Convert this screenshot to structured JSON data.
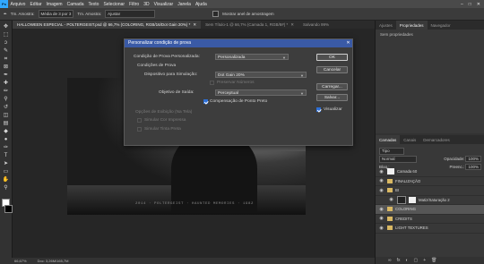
{
  "app": {
    "logo": "Ps"
  },
  "menu": [
    "Arquivo",
    "Editar",
    "Imagem",
    "Camada",
    "Texto",
    "Selecionar",
    "Filtro",
    "3D",
    "Visualizar",
    "Janela",
    "Ajuda"
  ],
  "window_controls": [
    "–",
    "□",
    "✕"
  ],
  "options_bar": {
    "size_label": "Tm. Amostra:",
    "size_value": "Média de 3 por 3",
    "sample_label": "Tm. Amostra:",
    "sample_value": "Ajustar",
    "checkbox_label": "Mostrar anel de amostragem"
  },
  "tabs": {
    "active": "HALLOWEEN ESPECIAL - POLTERGEIST.psd @ 66,7% (COLORING, RGB/16/Dot Gain 20%) *",
    "inactive": "Sem Título-1 @ 66,7% (Camada 1, RGB/8#) *",
    "inactive2": "Salvando 99%"
  },
  "photo": {
    "caption": "2014 · POLTERGEIST · HAUNTED MEMORIES · 1982"
  },
  "status": {
    "zoom": "66,67%",
    "doc": "Doc: 3,26M/165,7M"
  },
  "panels": {
    "top_tabs": [
      "Ajustes",
      "Propriedades",
      "Navegador"
    ],
    "properties_text": "Sem propriedades",
    "layer_tabs": [
      "Camadas",
      "Canais",
      "Demarcadores"
    ],
    "kind_label": "Tipo",
    "blend_mode": "Normal",
    "opacity_label": "Opacidade:",
    "opacity_value": "100%",
    "lock_label": "Bloq.:",
    "fill_label": "Preenc.:",
    "fill_value": "100%",
    "layers": [
      {
        "name": "Camada 60",
        "type": "layer"
      },
      {
        "name": "FINALIZAÇÃO",
        "type": "folder"
      },
      {
        "name": "BI",
        "type": "folder"
      },
      {
        "name": "Matiz/Saturação 2",
        "type": "adjustment"
      },
      {
        "name": "COLORING",
        "type": "folder",
        "selected": true
      },
      {
        "name": "CREDITS",
        "type": "folder"
      },
      {
        "name": "LIGHT TEXTURES",
        "type": "folder"
      }
    ],
    "footer_icons": [
      "∞",
      "fx",
      "◐",
      "▢",
      "+",
      "🗑"
    ]
  },
  "dialog": {
    "title": "Personalizar condição de prova",
    "close": "✕",
    "custom_label": "Condição de Prova Personalizada:",
    "custom_value": "Personalizada",
    "proof_conditions_heading": "Condições de Prova",
    "device_label": "Dispositivo para Simulação:",
    "device_value": "Dot Gain 20%",
    "preserve_label": "Preservar Números",
    "intent_label": "Objetivo de Saída:",
    "intent_value": "Perceptual",
    "bpc_label": "Compensação de Ponto Preto",
    "display_heading": "Opções de Exibição (Na Tela)",
    "paper_label": "Simular Cor Impressa",
    "ink_label": "Simular Tinta Preta",
    "ok": "OK",
    "cancel": "Cancelar",
    "load": "Carregar...",
    "save": "Salvar...",
    "preview": "Visualizar"
  },
  "colors": {
    "accent": "#2d6fd6",
    "titlebar": "#3a5aa6",
    "ps_blue": "#31a8ff"
  }
}
